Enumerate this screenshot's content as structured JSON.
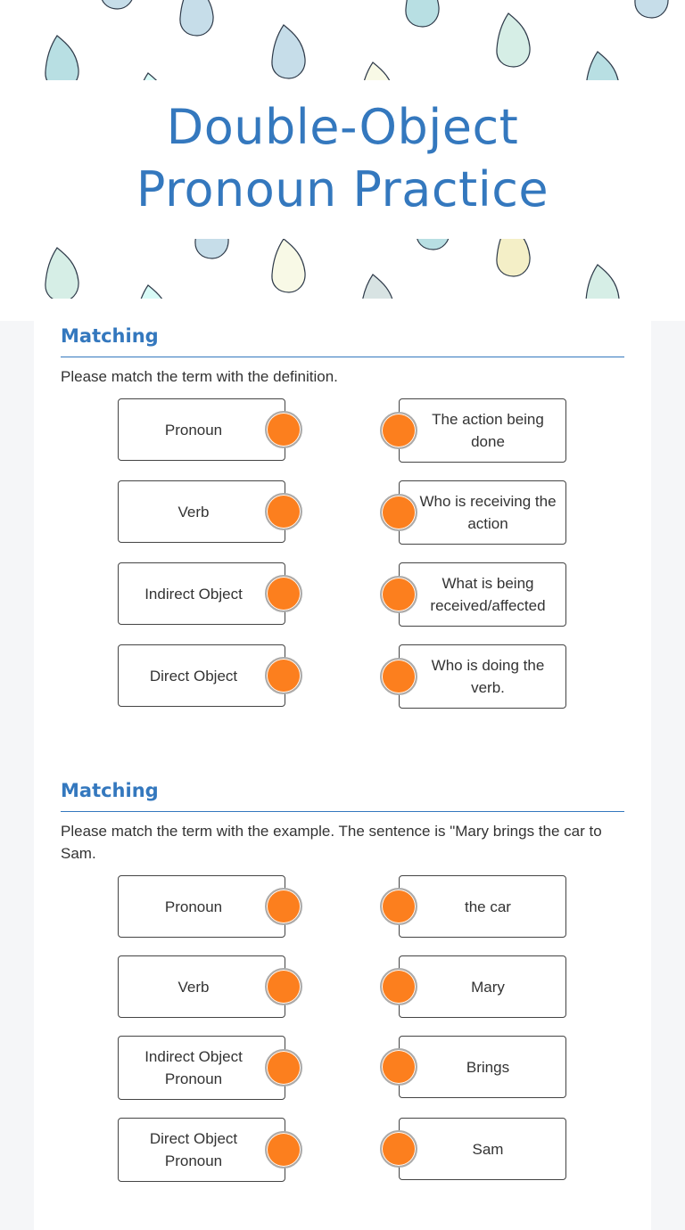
{
  "header": {
    "title_line1": "Double-Object",
    "title_line2": "Pronoun Practice",
    "background_pattern": "raindrops-icon",
    "title_color": "#3478be"
  },
  "sections": [
    {
      "title": "Matching",
      "instructions": "Please match the term with the definition.",
      "left_items": [
        "Pronoun",
        "Verb",
        "Indirect Object",
        "Direct Object"
      ],
      "right_items": [
        "The action being done",
        "Who is receiving the action",
        "What is being received/affected",
        "Who is doing the verb."
      ]
    },
    {
      "title": "Matching",
      "instructions": "Please match the term with the example. The sentence is \"Mary brings the car to Sam.",
      "left_items": [
        "Pronoun",
        "Verb",
        "Indirect Object Pronoun",
        "Direct Object Pronoun"
      ],
      "right_items": [
        "the car",
        "Mary",
        "Brings",
        "Sam"
      ]
    }
  ],
  "colors": {
    "accent": "#3478be",
    "connector_dot": "#fc7f1e",
    "page_background": "#f5f6f8"
  }
}
